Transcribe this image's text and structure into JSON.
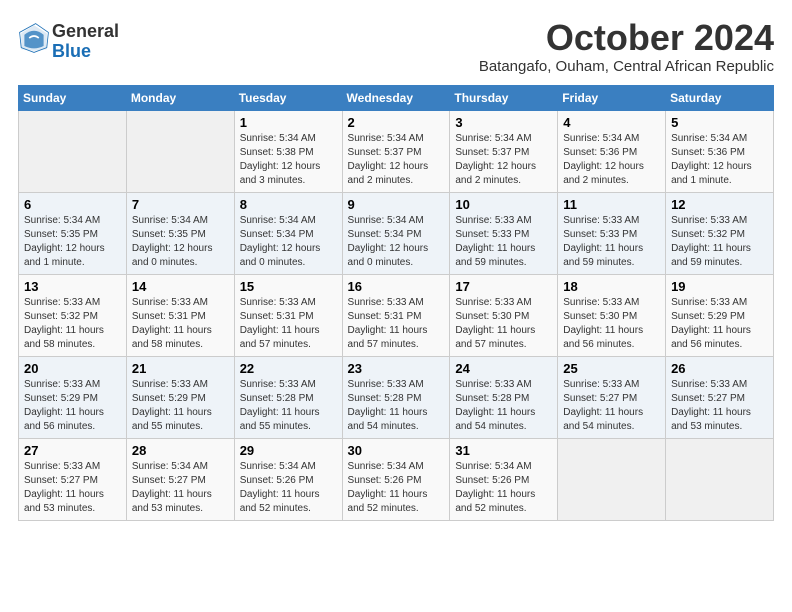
{
  "logo": {
    "general": "General",
    "blue": "Blue"
  },
  "header": {
    "month": "October 2024",
    "location": "Batangafo, Ouham, Central African Republic"
  },
  "weekdays": [
    "Sunday",
    "Monday",
    "Tuesday",
    "Wednesday",
    "Thursday",
    "Friday",
    "Saturday"
  ],
  "weeks": [
    [
      {
        "day": "",
        "sunrise": "",
        "sunset": "",
        "daylight": ""
      },
      {
        "day": "",
        "sunrise": "",
        "sunset": "",
        "daylight": ""
      },
      {
        "day": "1",
        "sunrise": "Sunrise: 5:34 AM",
        "sunset": "Sunset: 5:38 PM",
        "daylight": "Daylight: 12 hours and 3 minutes."
      },
      {
        "day": "2",
        "sunrise": "Sunrise: 5:34 AM",
        "sunset": "Sunset: 5:37 PM",
        "daylight": "Daylight: 12 hours and 2 minutes."
      },
      {
        "day": "3",
        "sunrise": "Sunrise: 5:34 AM",
        "sunset": "Sunset: 5:37 PM",
        "daylight": "Daylight: 12 hours and 2 minutes."
      },
      {
        "day": "4",
        "sunrise": "Sunrise: 5:34 AM",
        "sunset": "Sunset: 5:36 PM",
        "daylight": "Daylight: 12 hours and 2 minutes."
      },
      {
        "day": "5",
        "sunrise": "Sunrise: 5:34 AM",
        "sunset": "Sunset: 5:36 PM",
        "daylight": "Daylight: 12 hours and 1 minute."
      }
    ],
    [
      {
        "day": "6",
        "sunrise": "Sunrise: 5:34 AM",
        "sunset": "Sunset: 5:35 PM",
        "daylight": "Daylight: 12 hours and 1 minute."
      },
      {
        "day": "7",
        "sunrise": "Sunrise: 5:34 AM",
        "sunset": "Sunset: 5:35 PM",
        "daylight": "Daylight: 12 hours and 0 minutes."
      },
      {
        "day": "8",
        "sunrise": "Sunrise: 5:34 AM",
        "sunset": "Sunset: 5:34 PM",
        "daylight": "Daylight: 12 hours and 0 minutes."
      },
      {
        "day": "9",
        "sunrise": "Sunrise: 5:34 AM",
        "sunset": "Sunset: 5:34 PM",
        "daylight": "Daylight: 12 hours and 0 minutes."
      },
      {
        "day": "10",
        "sunrise": "Sunrise: 5:33 AM",
        "sunset": "Sunset: 5:33 PM",
        "daylight": "Daylight: 11 hours and 59 minutes."
      },
      {
        "day": "11",
        "sunrise": "Sunrise: 5:33 AM",
        "sunset": "Sunset: 5:33 PM",
        "daylight": "Daylight: 11 hours and 59 minutes."
      },
      {
        "day": "12",
        "sunrise": "Sunrise: 5:33 AM",
        "sunset": "Sunset: 5:32 PM",
        "daylight": "Daylight: 11 hours and 59 minutes."
      }
    ],
    [
      {
        "day": "13",
        "sunrise": "Sunrise: 5:33 AM",
        "sunset": "Sunset: 5:32 PM",
        "daylight": "Daylight: 11 hours and 58 minutes."
      },
      {
        "day": "14",
        "sunrise": "Sunrise: 5:33 AM",
        "sunset": "Sunset: 5:31 PM",
        "daylight": "Daylight: 11 hours and 58 minutes."
      },
      {
        "day": "15",
        "sunrise": "Sunrise: 5:33 AM",
        "sunset": "Sunset: 5:31 PM",
        "daylight": "Daylight: 11 hours and 57 minutes."
      },
      {
        "day": "16",
        "sunrise": "Sunrise: 5:33 AM",
        "sunset": "Sunset: 5:31 PM",
        "daylight": "Daylight: 11 hours and 57 minutes."
      },
      {
        "day": "17",
        "sunrise": "Sunrise: 5:33 AM",
        "sunset": "Sunset: 5:30 PM",
        "daylight": "Daylight: 11 hours and 57 minutes."
      },
      {
        "day": "18",
        "sunrise": "Sunrise: 5:33 AM",
        "sunset": "Sunset: 5:30 PM",
        "daylight": "Daylight: 11 hours and 56 minutes."
      },
      {
        "day": "19",
        "sunrise": "Sunrise: 5:33 AM",
        "sunset": "Sunset: 5:29 PM",
        "daylight": "Daylight: 11 hours and 56 minutes."
      }
    ],
    [
      {
        "day": "20",
        "sunrise": "Sunrise: 5:33 AM",
        "sunset": "Sunset: 5:29 PM",
        "daylight": "Daylight: 11 hours and 56 minutes."
      },
      {
        "day": "21",
        "sunrise": "Sunrise: 5:33 AM",
        "sunset": "Sunset: 5:29 PM",
        "daylight": "Daylight: 11 hours and 55 minutes."
      },
      {
        "day": "22",
        "sunrise": "Sunrise: 5:33 AM",
        "sunset": "Sunset: 5:28 PM",
        "daylight": "Daylight: 11 hours and 55 minutes."
      },
      {
        "day": "23",
        "sunrise": "Sunrise: 5:33 AM",
        "sunset": "Sunset: 5:28 PM",
        "daylight": "Daylight: 11 hours and 54 minutes."
      },
      {
        "day": "24",
        "sunrise": "Sunrise: 5:33 AM",
        "sunset": "Sunset: 5:28 PM",
        "daylight": "Daylight: 11 hours and 54 minutes."
      },
      {
        "day": "25",
        "sunrise": "Sunrise: 5:33 AM",
        "sunset": "Sunset: 5:27 PM",
        "daylight": "Daylight: 11 hours and 54 minutes."
      },
      {
        "day": "26",
        "sunrise": "Sunrise: 5:33 AM",
        "sunset": "Sunset: 5:27 PM",
        "daylight": "Daylight: 11 hours and 53 minutes."
      }
    ],
    [
      {
        "day": "27",
        "sunrise": "Sunrise: 5:33 AM",
        "sunset": "Sunset: 5:27 PM",
        "daylight": "Daylight: 11 hours and 53 minutes."
      },
      {
        "day": "28",
        "sunrise": "Sunrise: 5:34 AM",
        "sunset": "Sunset: 5:27 PM",
        "daylight": "Daylight: 11 hours and 53 minutes."
      },
      {
        "day": "29",
        "sunrise": "Sunrise: 5:34 AM",
        "sunset": "Sunset: 5:26 PM",
        "daylight": "Daylight: 11 hours and 52 minutes."
      },
      {
        "day": "30",
        "sunrise": "Sunrise: 5:34 AM",
        "sunset": "Sunset: 5:26 PM",
        "daylight": "Daylight: 11 hours and 52 minutes."
      },
      {
        "day": "31",
        "sunrise": "Sunrise: 5:34 AM",
        "sunset": "Sunset: 5:26 PM",
        "daylight": "Daylight: 11 hours and 52 minutes."
      },
      {
        "day": "",
        "sunrise": "",
        "sunset": "",
        "daylight": ""
      },
      {
        "day": "",
        "sunrise": "",
        "sunset": "",
        "daylight": ""
      }
    ]
  ]
}
